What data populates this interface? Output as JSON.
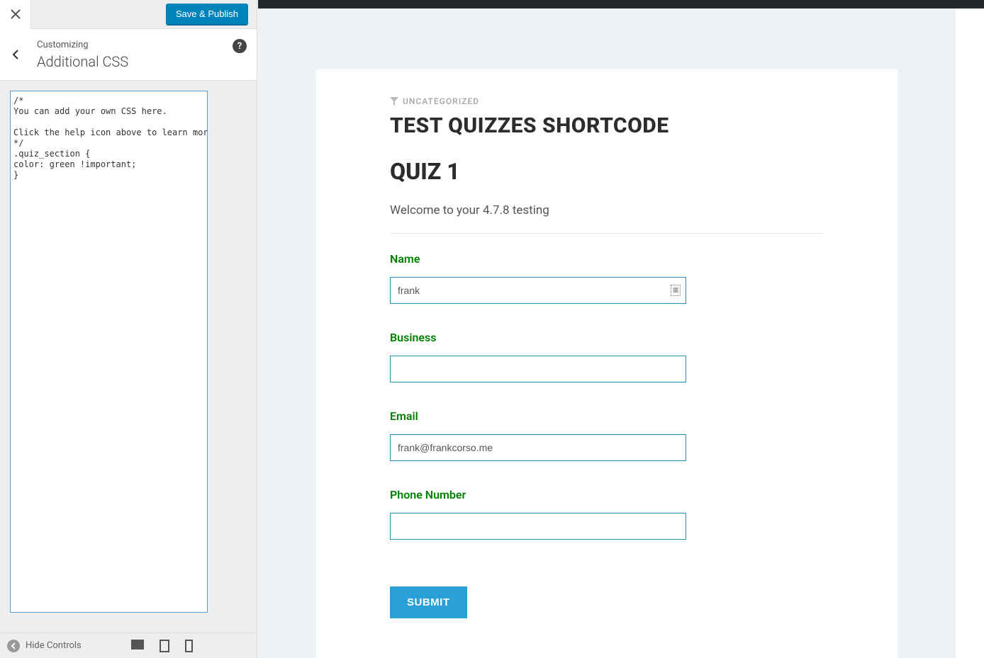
{
  "sidebar": {
    "publish_label": "Save & Publish",
    "customizing_label": "Customizing",
    "section_title": "Additional CSS",
    "help_tooltip": "?",
    "code": "/*\nYou can add your own CSS here.\n\nClick the help icon above to learn more.\n*/\n.quiz_section {\ncolor: green !important;\n}",
    "hide_controls_label": "Hide Controls"
  },
  "preview": {
    "category": "UNCATEGORIZED",
    "post_title": "TEST QUIZZES SHORTCODE",
    "quiz_title": "QUIZ 1",
    "welcome_text": "Welcome to your 4.7.8 testing",
    "fields": {
      "name": {
        "label": "Name",
        "value": "frank"
      },
      "business": {
        "label": "Business",
        "value": ""
      },
      "email": {
        "label": "Email",
        "value": "frank@frankcorso.me"
      },
      "phone": {
        "label": "Phone Number",
        "value": ""
      }
    },
    "submit_label": "SUBMIT"
  }
}
